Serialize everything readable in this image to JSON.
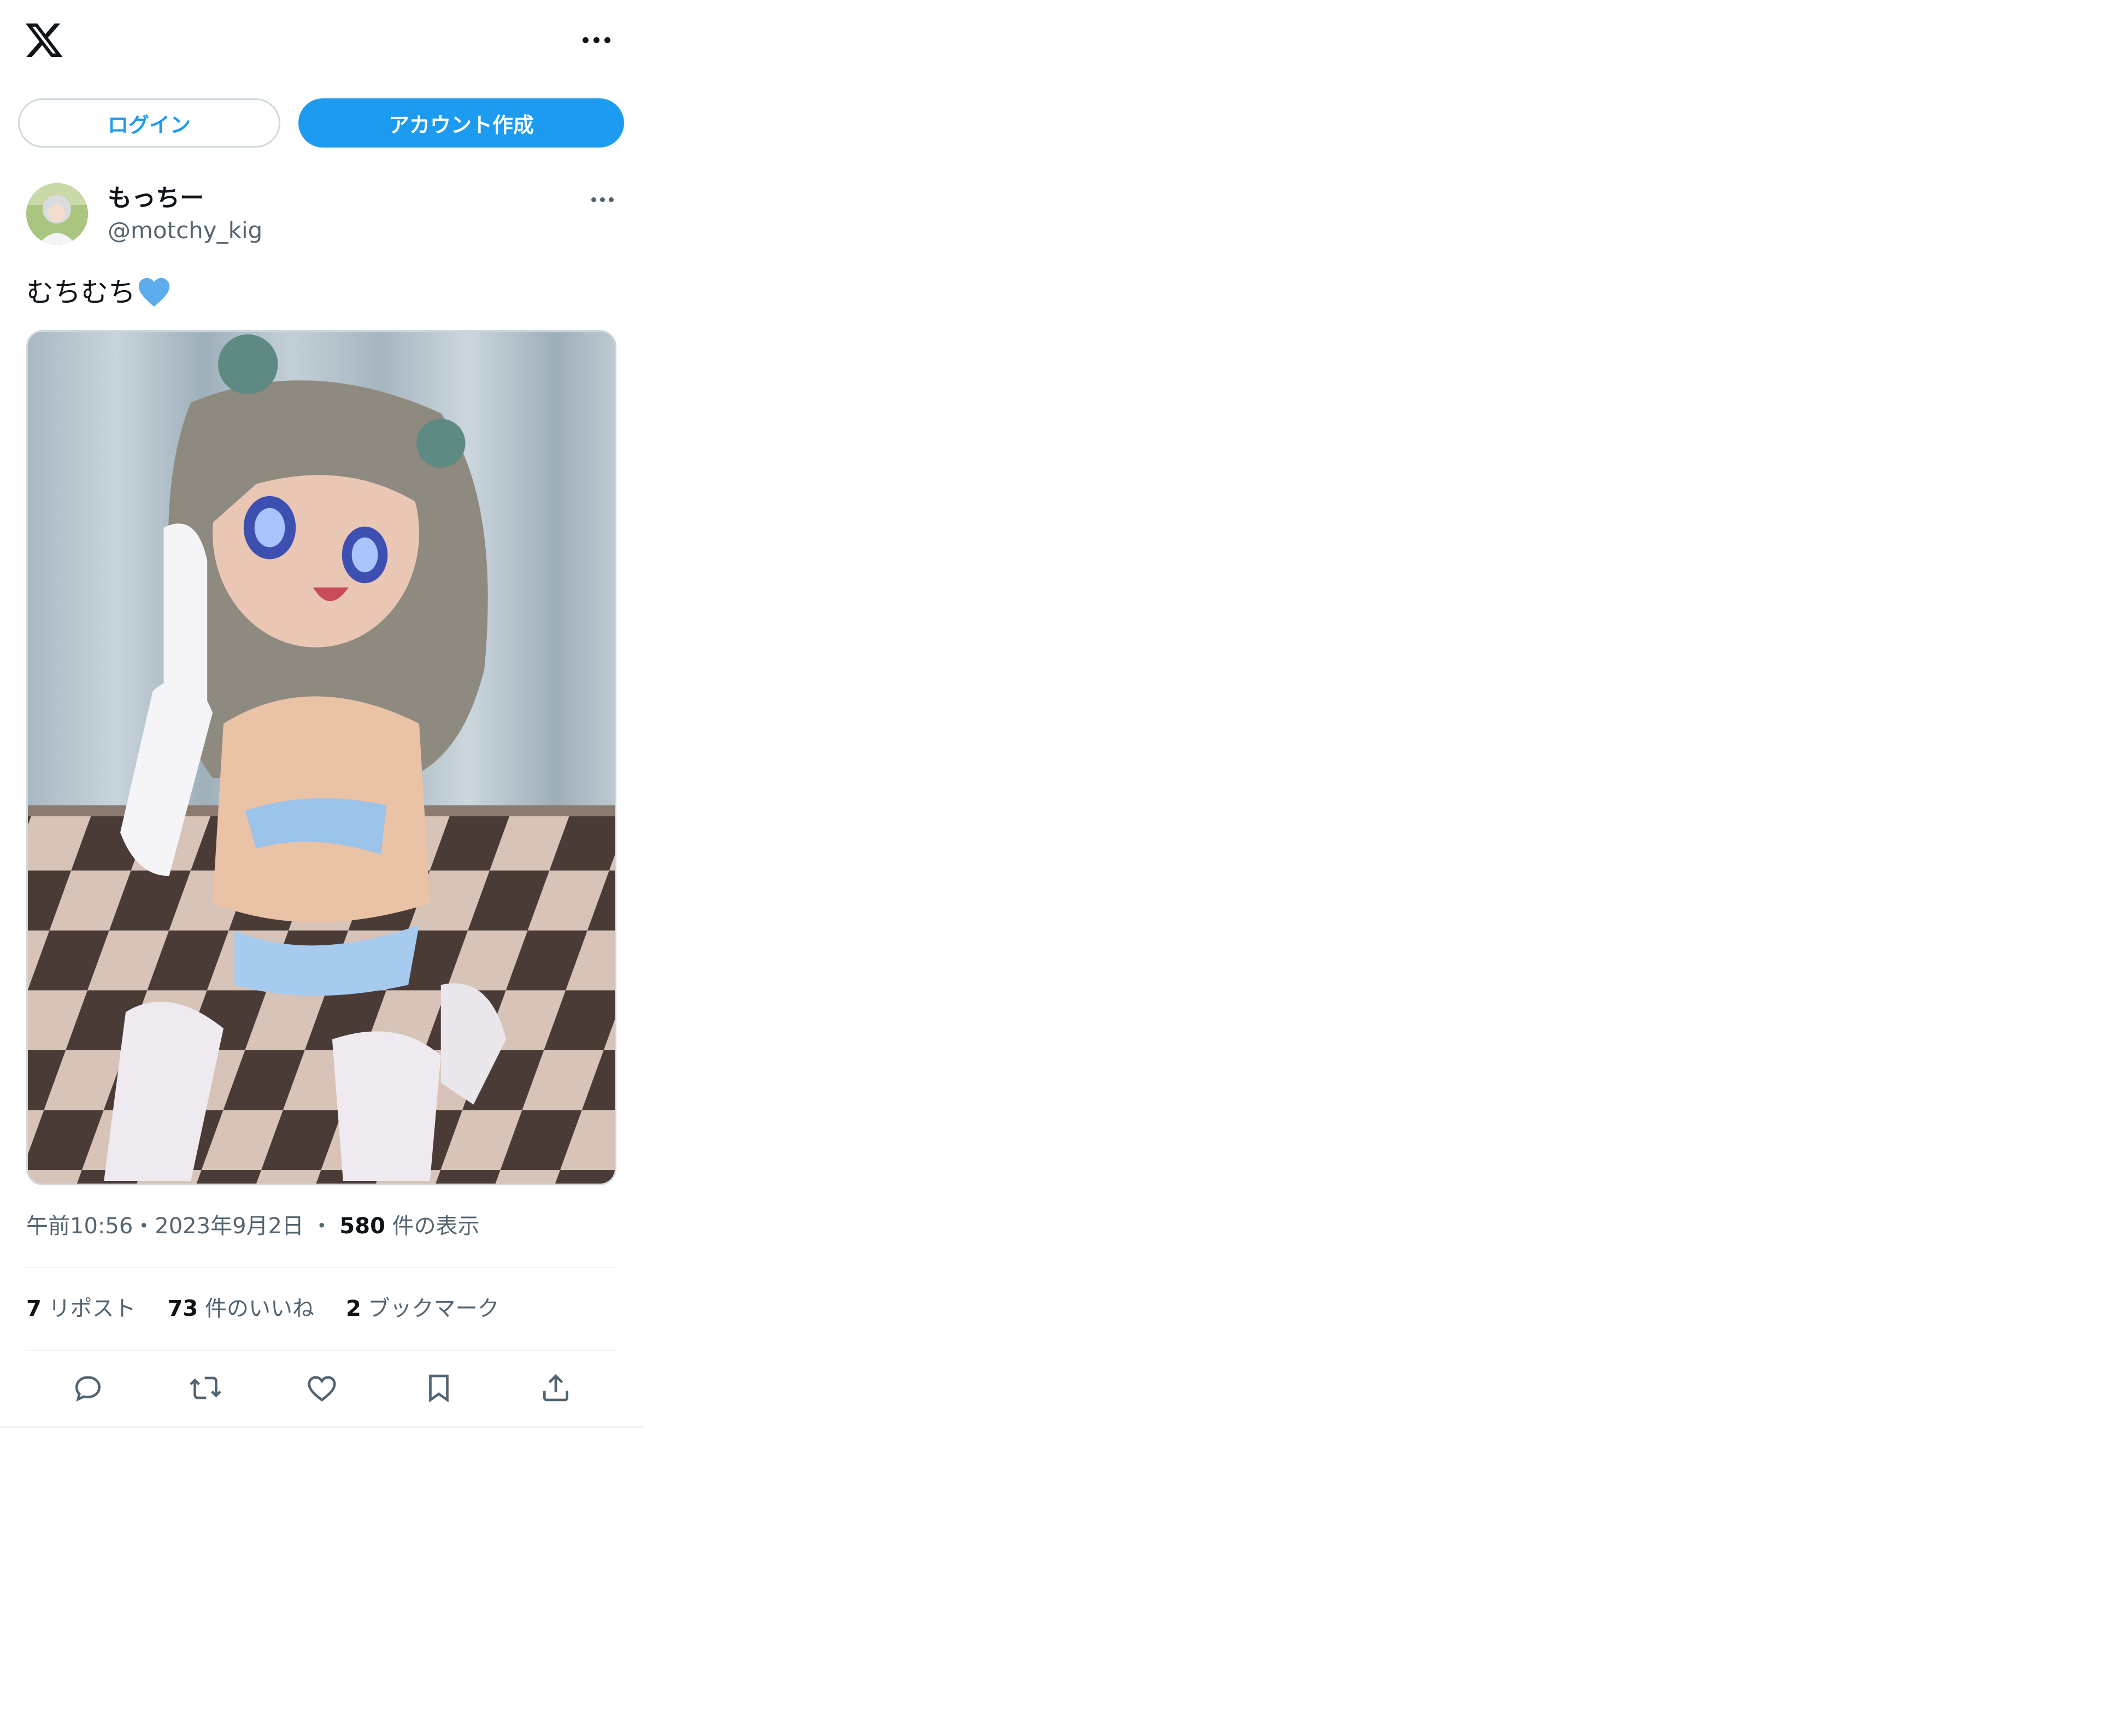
{
  "header": {
    "logo_icon": "x-logo-icon",
    "more_icon": "more-horizontal-icon"
  },
  "auth": {
    "login_label": "ログイン",
    "signup_label": "アカウント作成"
  },
  "post": {
    "display_name": "もっちー",
    "handle": "@motchy_kig",
    "text": "むちむち",
    "text_emoji": "blue-heart-emoji",
    "more_icon": "more-horizontal-icon",
    "media_description": "photo",
    "time": "午前10:56",
    "date": "2023年9月2日",
    "separator": "・",
    "views_count": "580",
    "views_label": "件の表示",
    "stats": {
      "reposts_count": "7",
      "reposts_label": "リポスト",
      "likes_count": "73",
      "likes_label": "件のいいね",
      "bookmarks_count": "2",
      "bookmarks_label": "ブックマーク"
    },
    "actions": [
      "reply-icon",
      "repost-icon",
      "like-icon",
      "bookmark-icon",
      "share-icon"
    ]
  },
  "colors": {
    "accent": "#1d9bf0",
    "text_primary": "#0f1419",
    "text_secondary": "#536471",
    "border": "#cfd9de"
  }
}
